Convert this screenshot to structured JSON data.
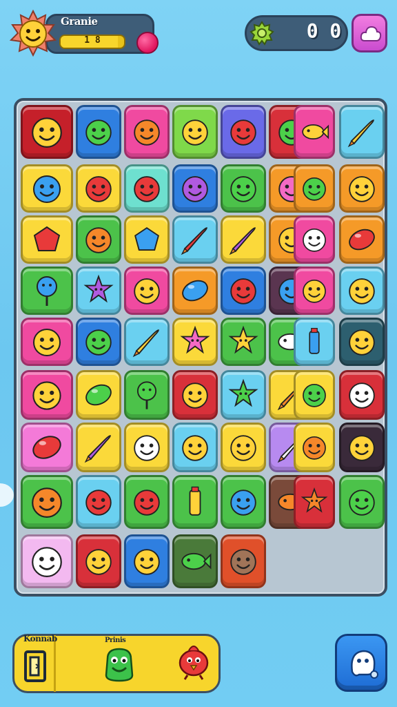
{
  "header": {
    "player_name": "Granie",
    "level_value": "1 8",
    "level_progress": 0.9,
    "score_value": "0 0"
  },
  "board": {
    "tiles": [
      {
        "icon": "smiley-face-icon",
        "color": "#c5202a"
      },
      {
        "icon": "green-alien-icon",
        "color": "#2f7fe0"
      },
      {
        "icon": "orange-monster-icon",
        "color": "#f04aa0"
      },
      {
        "icon": "yellow-bug-icon",
        "color": "#7fd94a"
      },
      {
        "icon": "red-apple-face-icon",
        "color": "#6a6ae8"
      },
      {
        "icon": "green-monster-icon",
        "color": "#d8303a"
      },
      {
        "icon": "yellow-fish-icon",
        "color": "#f04aa0"
      },
      {
        "icon": "rocket-icon",
        "color": "#6ad0f0"
      },
      {
        "icon": "blue-bird-icon",
        "color": "#fbd93a"
      },
      {
        "icon": "red-blob-icon",
        "color": "#fbd93a"
      },
      {
        "icon": "red-octopus-icon",
        "color": "#6ee0cf"
      },
      {
        "icon": "purple-robot-icon",
        "color": "#2f7fe0"
      },
      {
        "icon": "green-frog-icon",
        "color": "#4cc24a"
      },
      {
        "icon": "pink-bird-icon",
        "color": "#f59a28"
      },
      {
        "icon": "green-smiley-icon",
        "color": "#f59a28"
      },
      {
        "icon": "yellow-laugh-icon",
        "color": "#f59a28"
      },
      {
        "icon": "red-gem-icon",
        "color": "#fbd93a"
      },
      {
        "icon": "orange-bug-icon",
        "color": "#4cc24a"
      },
      {
        "icon": "blue-box-icon",
        "color": "#fbd93a"
      },
      {
        "icon": "red-rocket-icon",
        "color": "#6ad0f0"
      },
      {
        "icon": "purple-rocket-icon",
        "color": "#fbd93a"
      },
      {
        "icon": "yellow-blob-icon",
        "color": "#f59a28"
      },
      {
        "icon": "white-ghost-icon",
        "color": "#f04aa0"
      },
      {
        "icon": "red-pill-icon",
        "color": "#f59a28"
      },
      {
        "icon": "blue-lollipop-icon",
        "color": "#4cc24a"
      },
      {
        "icon": "purple-star-icon",
        "color": "#6ad0f0"
      },
      {
        "icon": "yellow-smiley-icon",
        "color": "#f04aa0"
      },
      {
        "icon": "blue-drop-icon",
        "color": "#f59a28"
      },
      {
        "icon": "red-tomato-icon",
        "color": "#2f7fe0"
      },
      {
        "icon": "blue-face-icon",
        "color": "#5a3550"
      },
      {
        "icon": "yellow-face-icon",
        "color": "#f04aa0"
      },
      {
        "icon": "yellow-lemon-icon",
        "color": "#6ad0f0"
      },
      {
        "icon": "yellow-smiley-icon",
        "color": "#f04aa0"
      },
      {
        "icon": "green-blob-icon",
        "color": "#2f7fe0"
      },
      {
        "icon": "rocket-icon",
        "color": "#6ad0f0"
      },
      {
        "icon": "pink-flower-icon",
        "color": "#fbd93a"
      },
      {
        "icon": "yellow-sun-icon",
        "color": "#4cc24a"
      },
      {
        "icon": "white-fish-icon",
        "color": "#4cc24a"
      },
      {
        "icon": "blue-crayon-icon",
        "color": "#6ad0f0"
      },
      {
        "icon": "yellow-bug-icon",
        "color": "#2d5f6f"
      },
      {
        "icon": "yellow-smiley-icon",
        "color": "#f04aa0"
      },
      {
        "icon": "green-bean-icon",
        "color": "#fbd93a"
      },
      {
        "icon": "green-lollipop-icon",
        "color": "#4cc24a"
      },
      {
        "icon": "yellow-bird-icon",
        "color": "#d8303a"
      },
      {
        "icon": "green-star-icon",
        "color": "#6ad0f0"
      },
      {
        "icon": "orange-rocket-icon",
        "color": "#fbd93a"
      },
      {
        "icon": "green-blob-icon",
        "color": "#fbd93a"
      },
      {
        "icon": "white-monster-icon",
        "color": "#d8303a"
      },
      {
        "icon": "red-pill-icon",
        "color": "#f47ad8"
      },
      {
        "icon": "purple-rocket-icon",
        "color": "#fbd93a"
      },
      {
        "icon": "white-ghost-icon",
        "color": "#fbd93a"
      },
      {
        "icon": "yellow-bug-icon",
        "color": "#6ad0f0"
      },
      {
        "icon": "yellow-face-icon",
        "color": "#fbd93a"
      },
      {
        "icon": "white-rocket-icon",
        "color": "#b78af0"
      },
      {
        "icon": "orange-fruit-icon",
        "color": "#fbd93a"
      },
      {
        "icon": "yellow-bird-icon",
        "color": "#3a2a3a"
      },
      {
        "icon": "orange-bug-icon",
        "color": "#4cc24a"
      },
      {
        "icon": "red-apple-icon",
        "color": "#6ad0f0"
      },
      {
        "icon": "red-apple-face-icon",
        "color": "#4cc24a"
      },
      {
        "icon": "yellow-bottle-icon",
        "color": "#4cc24a"
      },
      {
        "icon": "blue-bird-icon",
        "color": "#4cc24a"
      },
      {
        "icon": "orange-fish-icon",
        "color": "#7a4a3a"
      },
      {
        "icon": "orange-sun-icon",
        "color": "#d8303a"
      },
      {
        "icon": "green-smiley-icon",
        "color": "#4cc24a"
      },
      {
        "icon": "white-ghost-icon",
        "color": "#f3b9f0"
      },
      {
        "icon": "yellow-laugh-icon",
        "color": "#d8303a"
      },
      {
        "icon": "yellow-bug-icon",
        "color": "#2f7fe0"
      },
      {
        "icon": "green-fish-icon",
        "color": "#4a7a3a"
      },
      {
        "icon": "brown-face-icon",
        "color": "#e0502a"
      }
    ]
  },
  "footer": {
    "left_label": "Konnab",
    "mid_label": "Prinis"
  }
}
